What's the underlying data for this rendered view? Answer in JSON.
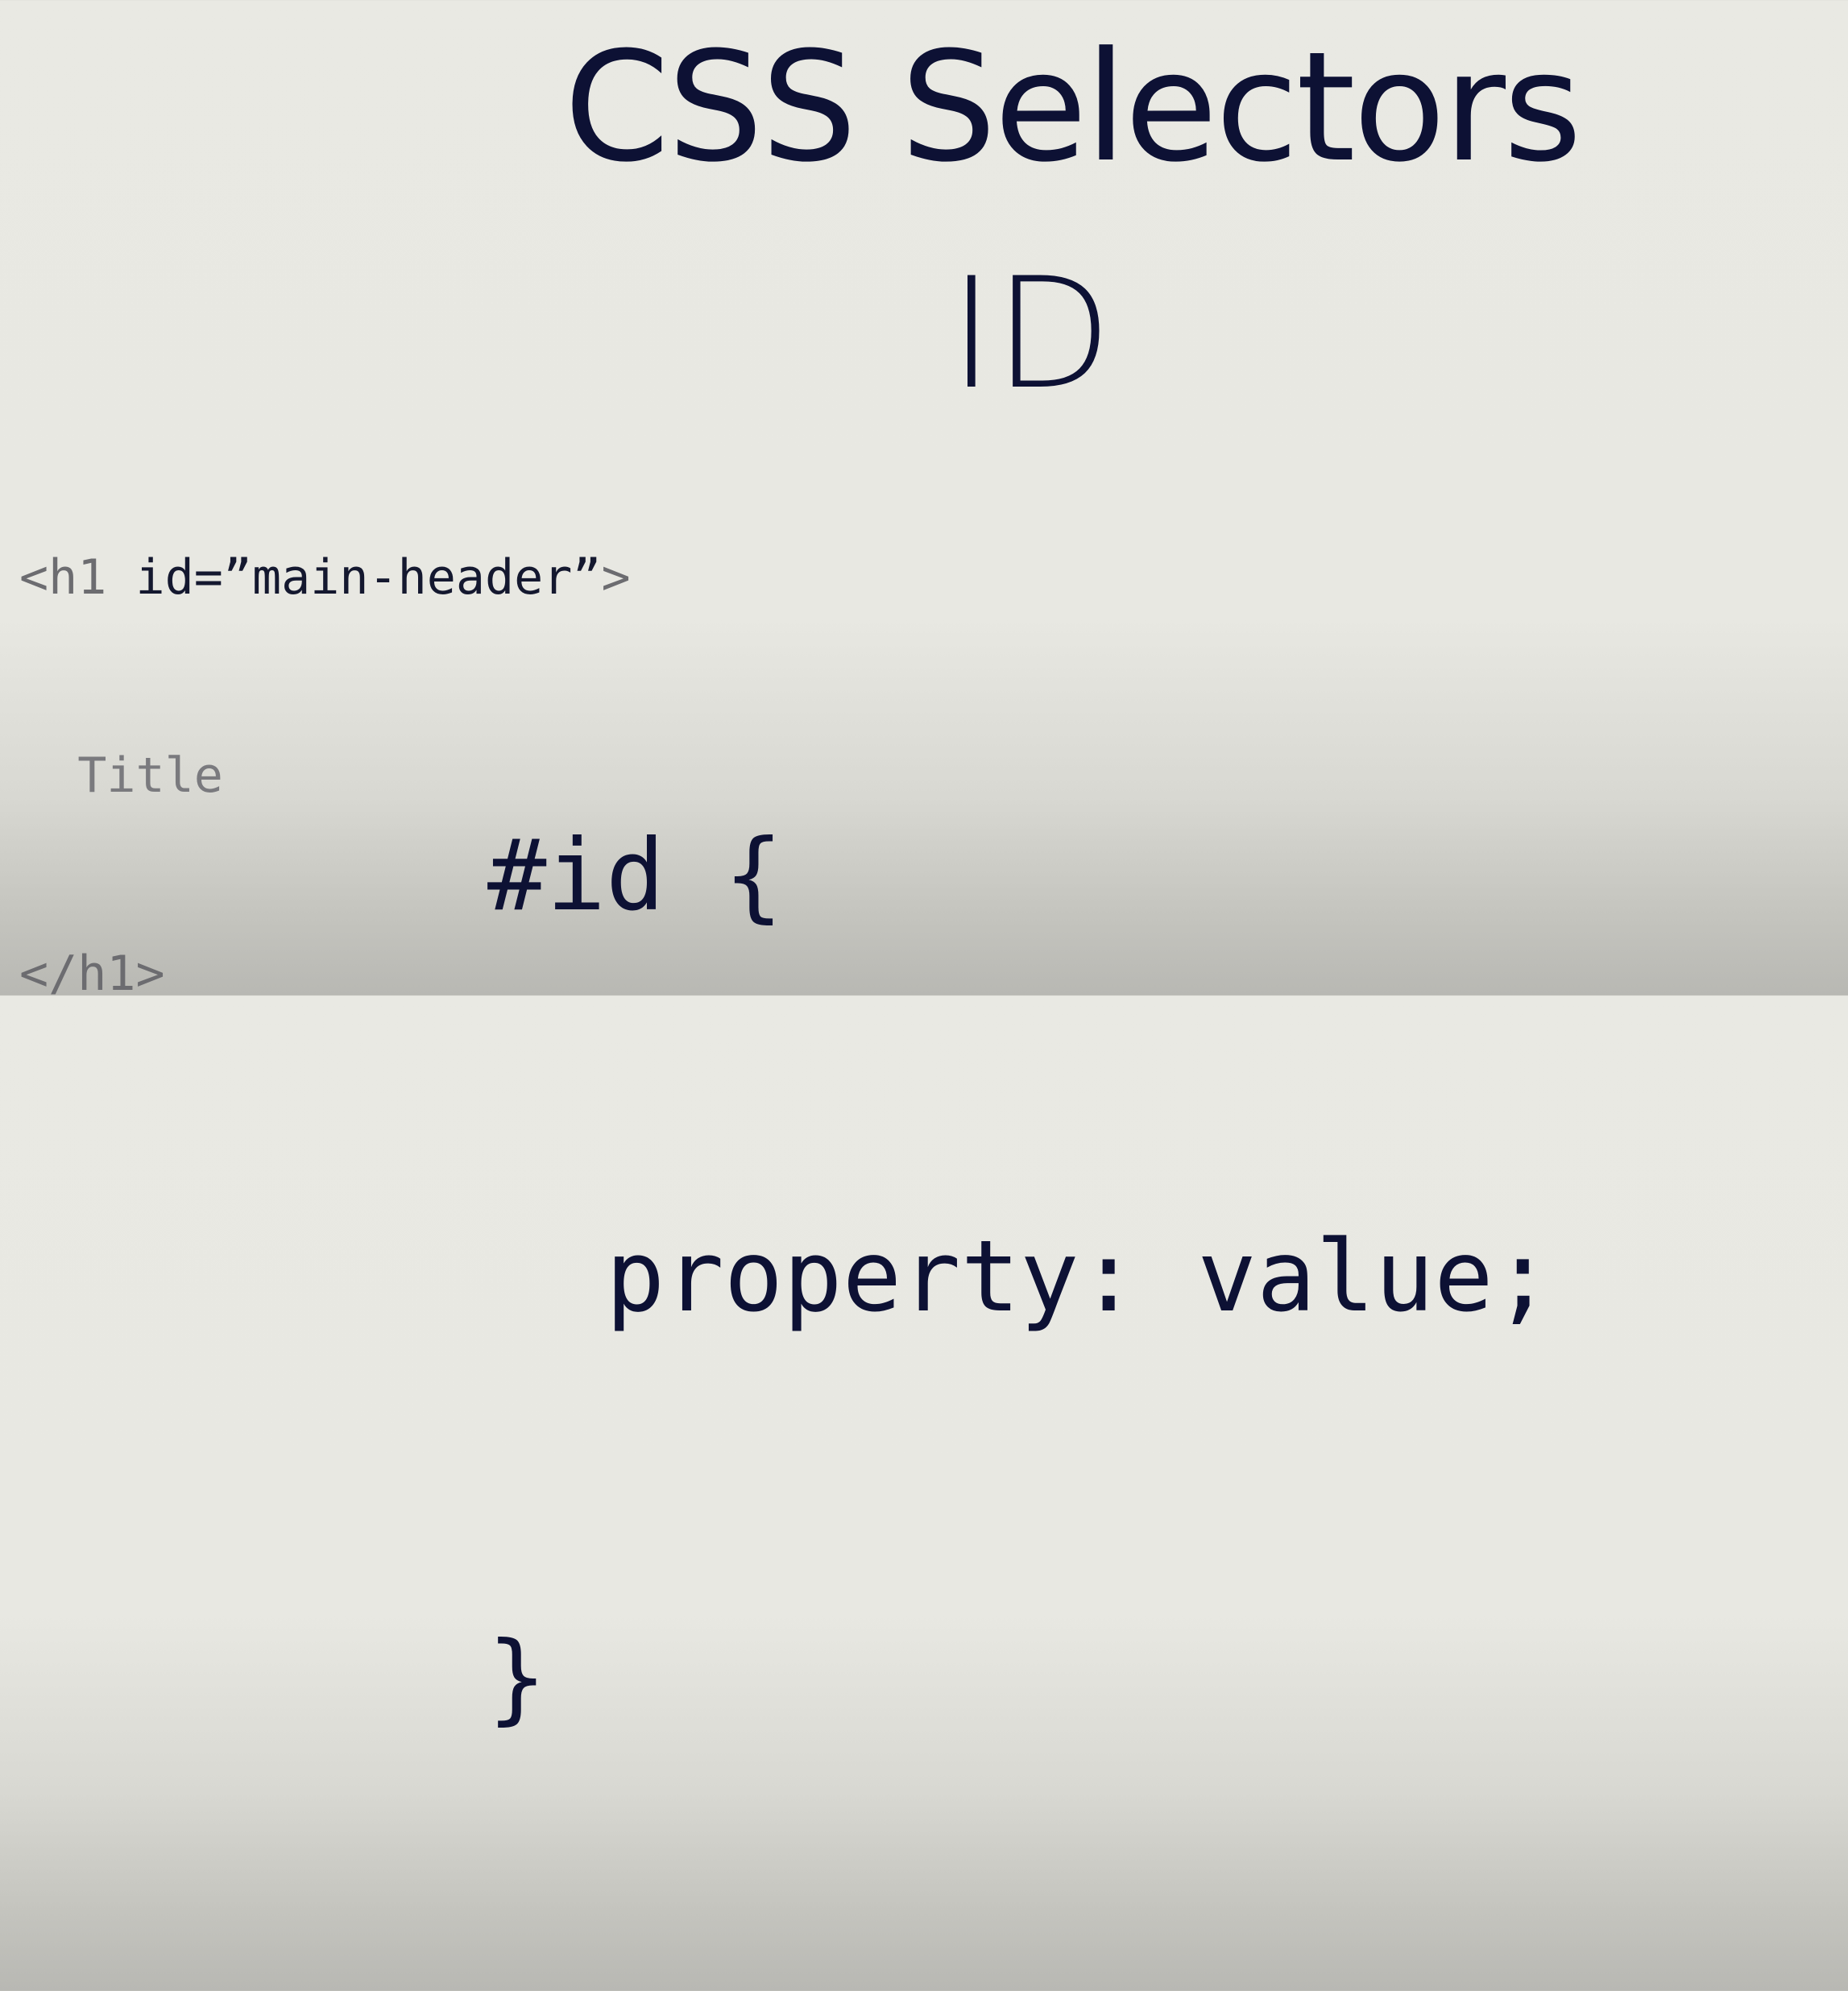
{
  "slide": {
    "title": "CSS Selectors",
    "subtitle": "ID"
  },
  "html_snippet": {
    "open_tag_start": "<h1 ",
    "attribute": "id=”main-header”",
    "open_tag_end": ">",
    "content": "  Title",
    "close_tag": "</h1>"
  },
  "css_code": {
    "selector_line": "#id {",
    "declaration_line": "  property: value;",
    "closing_line": "}"
  },
  "colors": {
    "background": "#e9e9e3",
    "text_primary": "#0d1134",
    "text_tag": "#6c6c70"
  }
}
